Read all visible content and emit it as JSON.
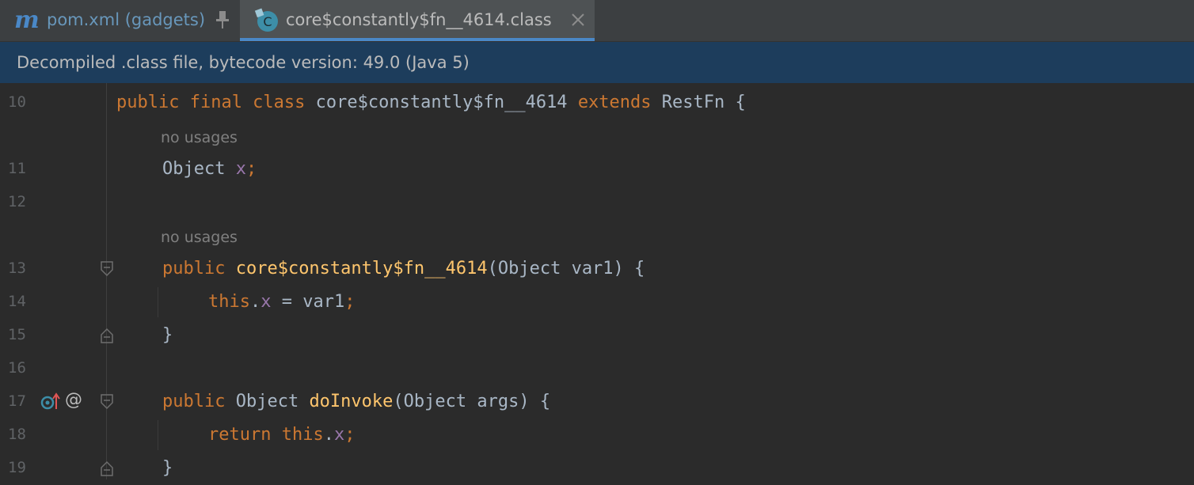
{
  "tabs": [
    {
      "label": "pom.xml (gadgets)",
      "icon": "maven-m-icon",
      "pinned": true
    },
    {
      "label": "core$constantly$fn__4614.class",
      "icon": "class-c-icon",
      "active": true
    }
  ],
  "maven_letter": "m",
  "class_letter": "C",
  "banner": {
    "text": "Decompiled .class file, bytecode version: 49.0 (Java 5)"
  },
  "hints": {
    "no_usages": "no usages"
  },
  "lines": {
    "l10": {
      "num": "10",
      "t1": "public final class ",
      "t2": "core$constantly$fn__4614 ",
      "t3": "extends ",
      "t4": "RestFn {"
    },
    "l11": {
      "num": "11",
      "t1": "Object ",
      "t2": "x",
      "t3": ";"
    },
    "l12": {
      "num": "12"
    },
    "l13": {
      "num": "13",
      "t1": "public ",
      "t2": "core$constantly$fn__4614",
      "t3": "(Object var1) {"
    },
    "l14": {
      "num": "14",
      "t1": "this",
      "t2": ".",
      "t3": "x",
      "t4": " = var1",
      "t5": ";"
    },
    "l15": {
      "num": "15",
      "t1": "}"
    },
    "l16": {
      "num": "16"
    },
    "l17": {
      "num": "17",
      "t1": "public ",
      "t2": "Object ",
      "t3": "doInvoke",
      "t4": "(Object args) {",
      "at": "@"
    },
    "l18": {
      "num": "18",
      "t1": "return ",
      "t2": "this",
      "t3": ".",
      "t4": "x",
      "t5": ";"
    },
    "l19": {
      "num": "19",
      "t1": "}"
    }
  },
  "colors": {
    "keyword": "#cc7832",
    "field": "#9876aa",
    "method": "#ffc66d",
    "text": "#a9b7c6",
    "banner_bg": "#1d3d5c",
    "tab_accent": "#4a88c7"
  }
}
